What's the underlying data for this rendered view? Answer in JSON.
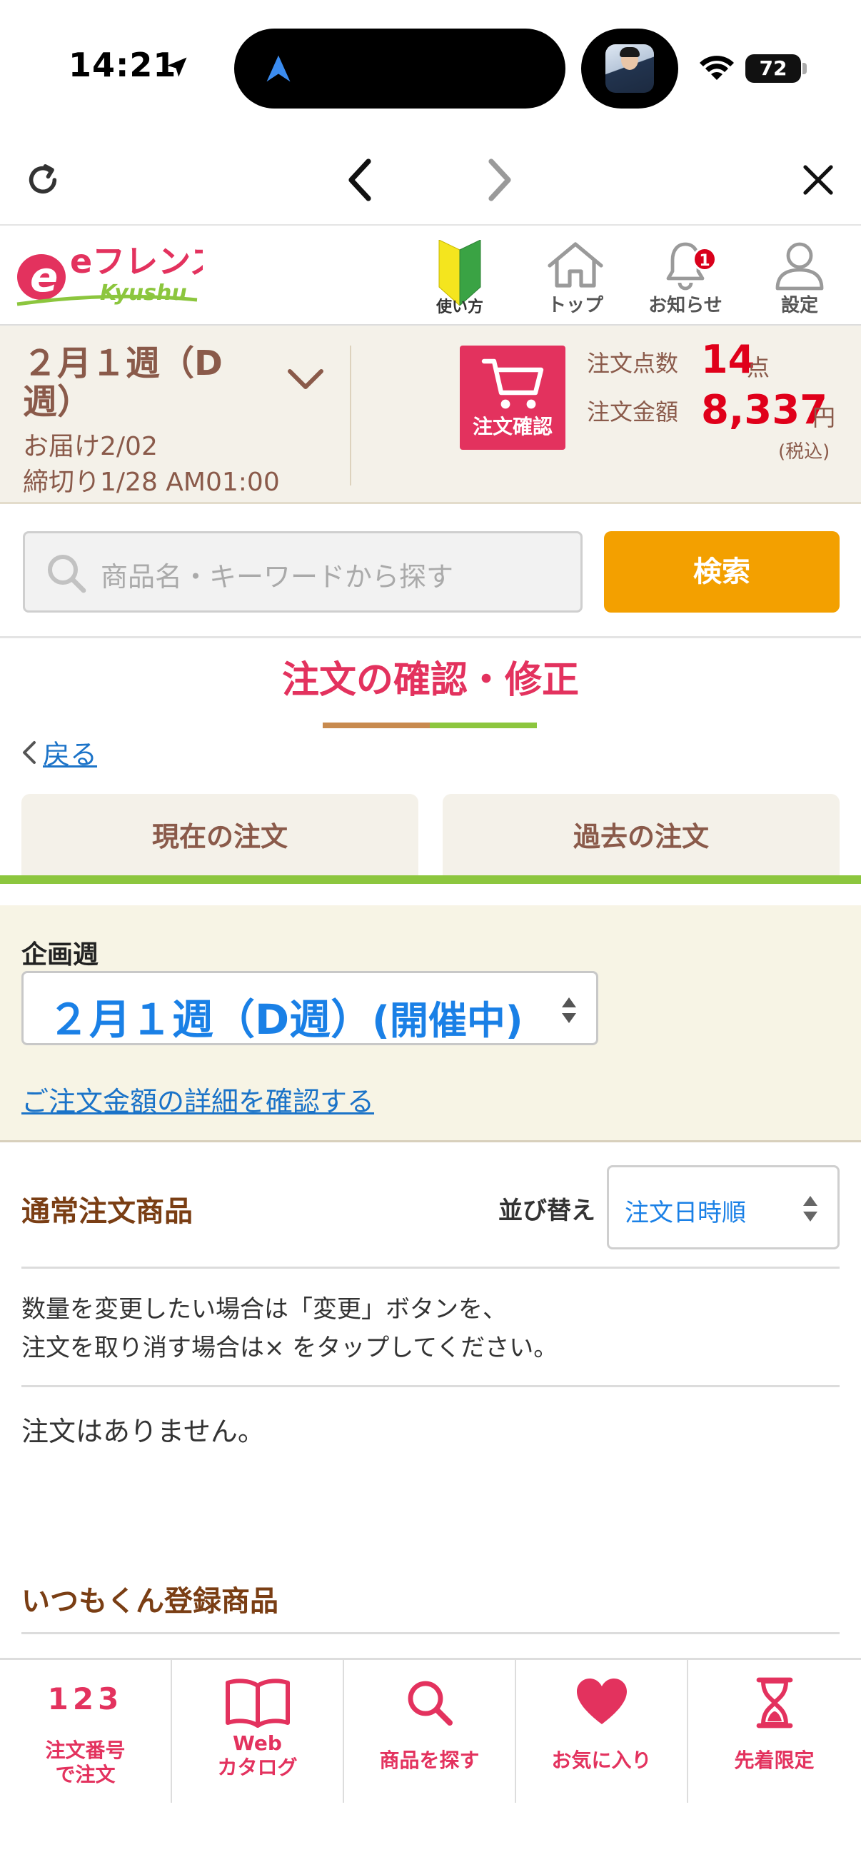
{
  "status_bar": {
    "time": "14:21",
    "battery": "72",
    "battery_level": 0.72
  },
  "header": {
    "logo_text": "eフレンズ",
    "logo_sub": "Kyushu",
    "items": [
      {
        "label": "使い方",
        "icon": "beginner-mark-icon"
      },
      {
        "label": "トップ",
        "icon": "home-icon"
      },
      {
        "label": "お知らせ",
        "icon": "bell-icon",
        "badge": "1"
      },
      {
        "label": "設定",
        "icon": "user-icon"
      }
    ]
  },
  "summary": {
    "week": "２月１週（D週）",
    "delivery": "お届け2/02",
    "deadline": "締切り1/28 AM01:00",
    "order_button": "注文確認",
    "count_label": "注文点数",
    "count_value": "14",
    "count_unit": "点",
    "amount_label": "注文金額",
    "amount_value": "8,337",
    "amount_unit": "円",
    "tax_note": "(税込)"
  },
  "search": {
    "placeholder": "商品名・キーワードから探す",
    "button": "検索"
  },
  "page": {
    "title": "注文の確認・修正",
    "back": "戻る",
    "tabs": [
      {
        "label": "現在の注文"
      },
      {
        "label": "過去の注文"
      }
    ]
  },
  "planning": {
    "label": "企画週",
    "selected_week": "２月１週（D週）",
    "selected_status": "(開催中)",
    "detail_link": "ご注文金額の詳細を確認する"
  },
  "normal_orders": {
    "title": "通常注文商品",
    "sort_label": "並び替え",
    "sort_value": "注文日時順",
    "instruction_1": "数量を変更したい場合は「変更」ボタンを、",
    "instruction_2": "注文を取り消す場合は× をタップしてください。",
    "empty_message": "注文はありません。"
  },
  "itsumokun": {
    "title": "いつもくん登録商品"
  },
  "bottom_nav": [
    {
      "number": "123",
      "label_1": "注文番号",
      "label_2": "で注文"
    },
    {
      "label_1": "Web",
      "label_2": "カタログ",
      "icon": "book-icon"
    },
    {
      "label_1": "商品を探す",
      "icon": "search-icon"
    },
    {
      "label_1": "お気に入り",
      "icon": "heart-icon"
    },
    {
      "label_1": "先着限定",
      "icon": "hourglass-icon"
    }
  ],
  "colors": {
    "brand_pink": "#e3325e",
    "accent_green": "#8cc63e",
    "search_orange": "#f3a000",
    "link_blue": "#1b73c8",
    "price_red": "#e0001a"
  }
}
